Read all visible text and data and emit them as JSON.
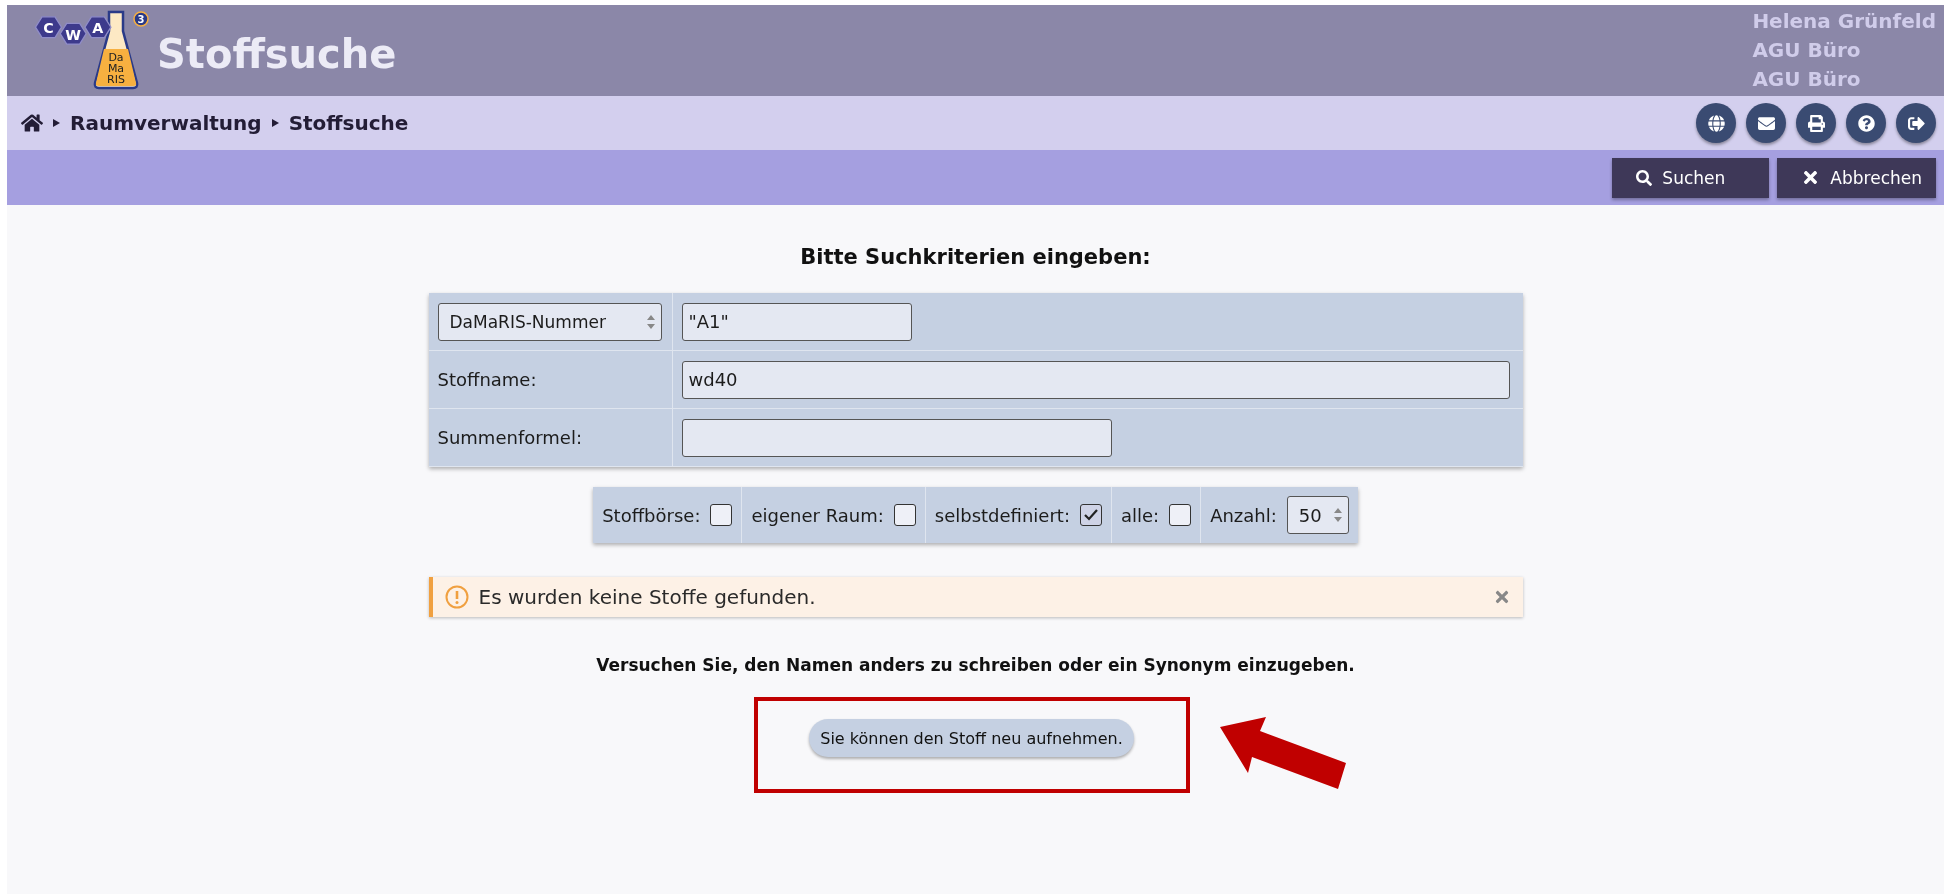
{
  "header": {
    "logo": {
      "cwa_letters": [
        "C",
        "W",
        "A"
      ],
      "flask_lines": [
        "Da",
        "Ma",
        "RIS"
      ],
      "version": "3"
    },
    "title": "Stoffsuche",
    "user_lines": [
      "Helena Grünfeld",
      "AGU Büro",
      "AGU Büro"
    ]
  },
  "breadcrumb": {
    "items": [
      "Raumverwaltung",
      "Stoffsuche"
    ]
  },
  "header_actions": [
    {
      "kind": "globe"
    },
    {
      "kind": "mail"
    },
    {
      "kind": "print"
    },
    {
      "kind": "help"
    },
    {
      "kind": "logout"
    }
  ],
  "toolbar": {
    "buttons": [
      {
        "kind": "search",
        "label": "Suchen"
      },
      {
        "kind": "cancel",
        "label": "Abbrechen"
      }
    ]
  },
  "form": {
    "heading": "Bitte Suchkriterien eingeben:",
    "rows": [
      {
        "kind": "select",
        "select_value": "DaMaRIS-Nummer",
        "value": "\"A1\""
      },
      {
        "kind": "label",
        "label": "Stoffname:",
        "value": "wd40"
      },
      {
        "kind": "label",
        "label": "Summenformel:"
      }
    ]
  },
  "filters": [
    {
      "kind": "checkbox",
      "label": "Stoffbörse:",
      "checked": false
    },
    {
      "kind": "checkbox",
      "label": "eigener Raum:",
      "checked": false
    },
    {
      "kind": "checkbox",
      "label": "selbstdefiniert:",
      "checked": true
    },
    {
      "kind": "checkbox",
      "label": "alle:",
      "checked": false
    },
    {
      "kind": "select",
      "label": "Anzahl:",
      "value": "50"
    }
  ],
  "alert": {
    "text": "Es wurden keine Stoffe gefunden."
  },
  "hint": "Versuchen Sie, den Namen anders zu schreiben oder ein Synonym einzugeben.",
  "new_button": {
    "label": "Sie können den Stoff neu aufnehmen."
  }
}
